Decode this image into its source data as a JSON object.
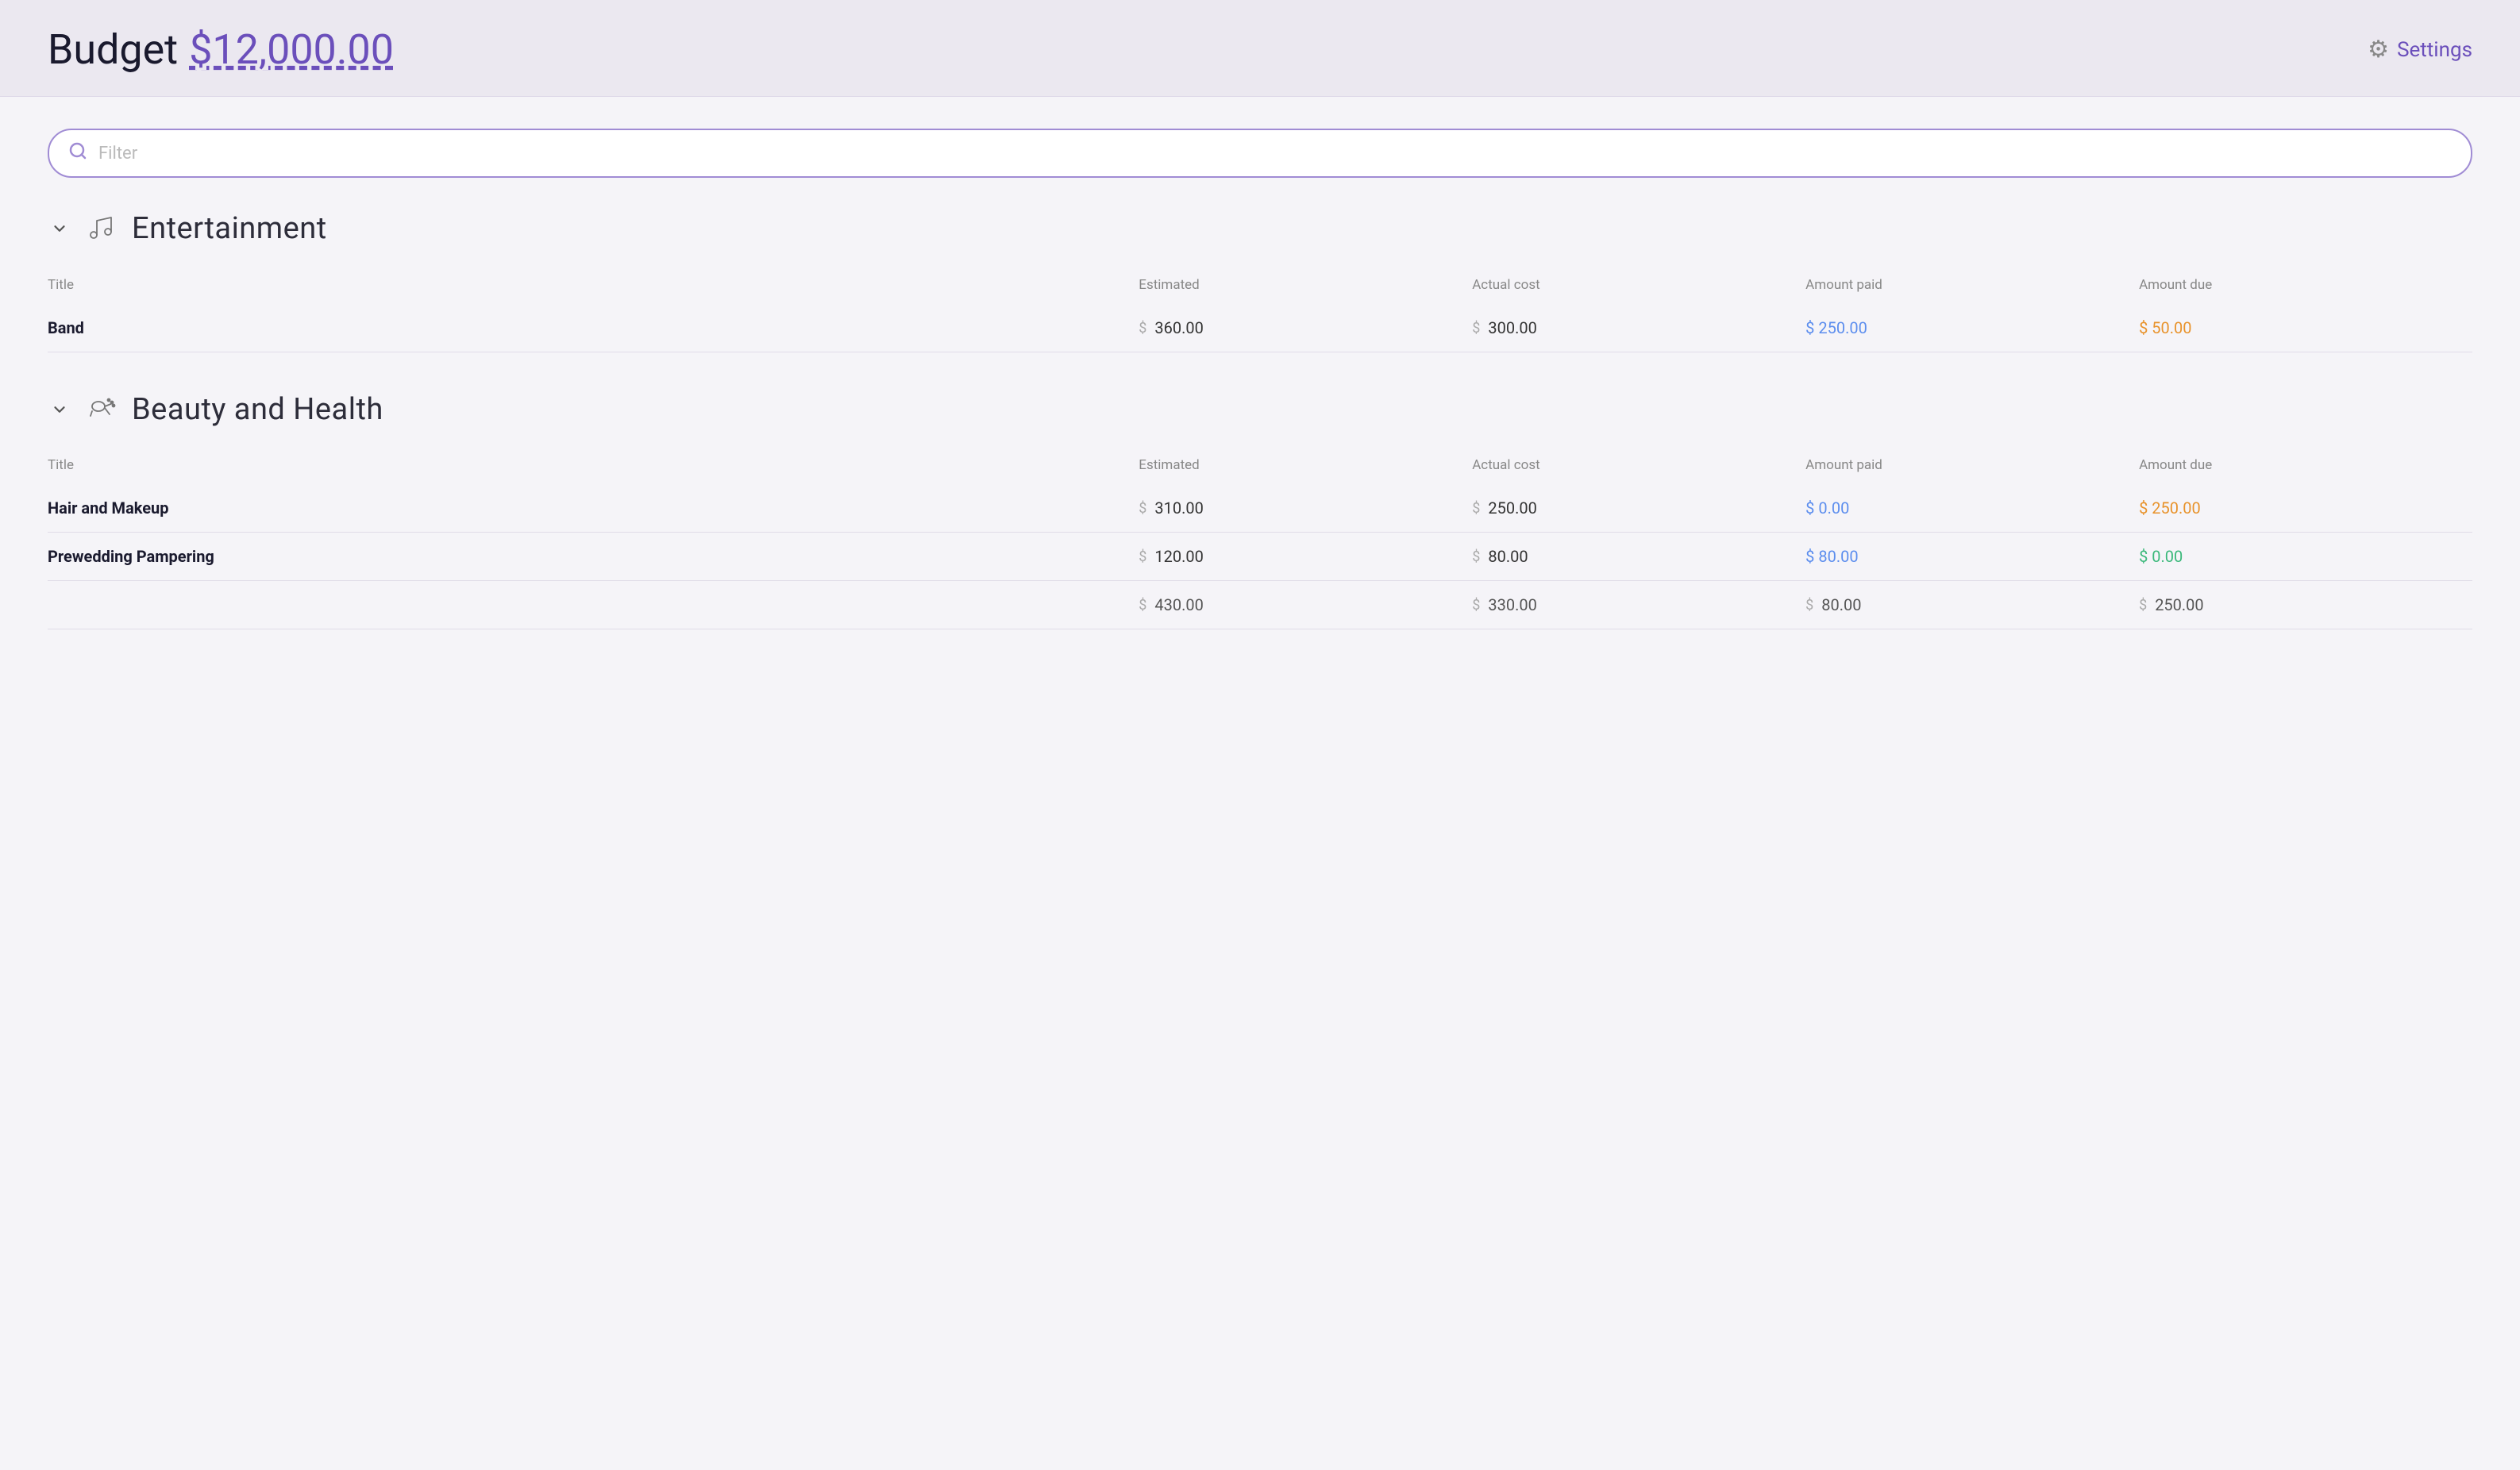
{
  "header": {
    "title": "Budget",
    "amount": "$12,000.00",
    "settings_label": "Settings"
  },
  "filter": {
    "placeholder": "Filter"
  },
  "sections": [
    {
      "id": "entertainment",
      "icon": "🎵",
      "title": "Entertainment",
      "columns": [
        "Title",
        "Estimated",
        "Actual cost",
        "Amount paid",
        "Amount due"
      ],
      "rows": [
        {
          "title": "Band",
          "estimated": "360.00",
          "actual_cost": "300.00",
          "amount_paid": "250.00",
          "amount_due": "50.00",
          "paid_color": "blue",
          "due_color": "orange"
        }
      ],
      "totals": {
        "estimated": "",
        "actual_cost": "",
        "amount_paid": "",
        "amount_due": ""
      }
    },
    {
      "id": "beauty-health",
      "icon": "💅",
      "title": "Beauty and Health",
      "columns": [
        "Title",
        "Estimated",
        "Actual cost",
        "Amount paid",
        "Amount due"
      ],
      "rows": [
        {
          "title": "Hair and Makeup",
          "estimated": "310.00",
          "actual_cost": "250.00",
          "amount_paid": "0.00",
          "amount_due": "250.00",
          "paid_color": "blue",
          "due_color": "orange"
        },
        {
          "title": "Prewedding Pampering",
          "estimated": "120.00",
          "actual_cost": "80.00",
          "amount_paid": "80.00",
          "amount_due": "0.00",
          "paid_color": "blue",
          "due_color": "green"
        }
      ],
      "totals": {
        "estimated": "430.00",
        "actual_cost": "330.00",
        "amount_paid": "80.00",
        "amount_due": "250.00"
      }
    }
  ],
  "icons": {
    "chevron_down": "∨",
    "search": "⌕",
    "gear": "⚙"
  }
}
